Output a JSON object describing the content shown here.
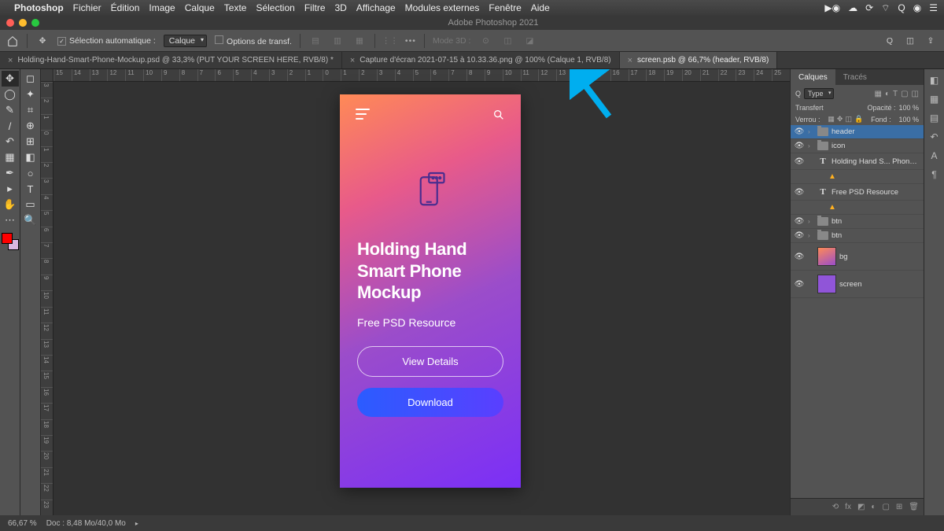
{
  "menubar": {
    "app": "Photoshop",
    "items": [
      "Fichier",
      "Édition",
      "Image",
      "Calque",
      "Texte",
      "Sélection",
      "Filtre",
      "3D",
      "Affichage",
      "Modules externes",
      "Fenêtre",
      "Aide"
    ]
  },
  "titlebar": "Adobe Photoshop 2021",
  "options": {
    "auto_select_label": "Sélection automatique :",
    "auto_select_value": "Calque",
    "transform_label": "Options de transf.",
    "mode3d_label": "Mode 3D :"
  },
  "tabs": [
    {
      "label": "Holding-Hand-Smart-Phone-Mockup.psd @ 33,3% (PUT YOUR SCREEN HERE, RVB/8) *",
      "active": false
    },
    {
      "label": "Capture d'écran 2021-07-15 à 10.33.36.png @ 100% (Calque 1, RVB/8)",
      "active": false
    },
    {
      "label": "screen.psb @ 66,7% (header, RVB/8)",
      "active": true
    }
  ],
  "ruler_h": [
    "15",
    "14",
    "13",
    "12",
    "11",
    "10",
    "9",
    "8",
    "7",
    "6",
    "5",
    "4",
    "3",
    "2",
    "1",
    "0",
    "1",
    "2",
    "3",
    "4",
    "5",
    "6",
    "7",
    "8",
    "9",
    "10",
    "11",
    "12",
    "13",
    "14",
    "15",
    "16",
    "17",
    "18",
    "19",
    "20",
    "21",
    "22",
    "23",
    "24",
    "25"
  ],
  "ruler_v": [
    "3",
    "2",
    "1",
    "0",
    "1",
    "2",
    "3",
    "4",
    "5",
    "6",
    "7",
    "8",
    "9",
    "10",
    "11",
    "12",
    "13",
    "14",
    "15",
    "16",
    "17",
    "18",
    "19",
    "20",
    "21",
    "22",
    "23"
  ],
  "mockup": {
    "title": "Holding Hand Smart Phone Mockup",
    "subtitle": "Free PSD Resource",
    "btn1": "View Details",
    "btn2": "Download"
  },
  "panels": {
    "tab1": "Calques",
    "tab2": "Tracés",
    "type_label": "Type",
    "blend_mode": "Transfert",
    "opacity_label": "Opacité :",
    "opacity_value": "100 %",
    "lock_label": "Verrou :",
    "fill_label": "Fond :",
    "fill_value": "100 %"
  },
  "layers": [
    {
      "type": "folder",
      "name": "header",
      "selected": true,
      "chev": "›"
    },
    {
      "type": "folder",
      "name": "icon",
      "chev": "›"
    },
    {
      "type": "text",
      "name": "Holding Hand S... Phone Mockup",
      "warn": true
    },
    {
      "type": "text",
      "name": "Free PSD Resource",
      "warn": true
    },
    {
      "type": "folder",
      "name": "btn",
      "chev": "›"
    },
    {
      "type": "folder",
      "name": "btn",
      "chev": "›"
    },
    {
      "type": "thumb",
      "name": "bg",
      "thumb": "bg",
      "tall": true
    },
    {
      "type": "thumb",
      "name": "screen",
      "thumb": "screen",
      "tall": true
    }
  ],
  "status": {
    "zoom": "66,67 %",
    "doc": "Doc : 8,48 Mo/40,0 Mo"
  }
}
